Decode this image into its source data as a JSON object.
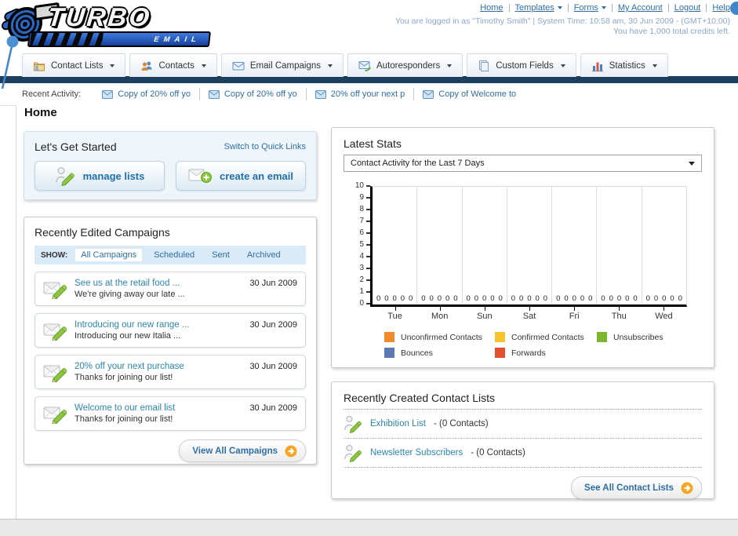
{
  "colors": {
    "navy_bar": "#1c3f60",
    "link_blue": "#2f6fa7",
    "accent_orange": "#f5a623",
    "pencil_green": "#8cc63e"
  },
  "header": {
    "logo_line1": "TURBO",
    "logo_line2": "EMAIL",
    "links": [
      {
        "label": "Home",
        "dropdown": false
      },
      {
        "label": "Templates",
        "dropdown": true
      },
      {
        "label": "Forms",
        "dropdown": true
      },
      {
        "label": "My Account",
        "dropdown": false
      },
      {
        "label": "Logout",
        "dropdown": false
      },
      {
        "label": "Help",
        "dropdown": false
      }
    ],
    "login_line": "You are logged in as \"Timothy Smith\" | System Time: 10:58 am, 30 Jun 2009 - (GMT+10:00)",
    "credits_line": "You have 1,000 total credits left."
  },
  "nav": {
    "tabs": [
      {
        "label": "Contact Lists",
        "icon": "folder"
      },
      {
        "label": "Contacts",
        "icon": "people"
      },
      {
        "label": "Email Campaigns",
        "icon": "envelope"
      },
      {
        "label": "Autoresponders",
        "icon": "envelope-arrow"
      },
      {
        "label": "Custom Fields",
        "icon": "pages"
      },
      {
        "label": "Statistics",
        "icon": "barchart"
      }
    ]
  },
  "recent_activity": {
    "label": "Recent Activity:",
    "items": [
      "Copy of 20% off yo",
      "Copy of 20% off yo",
      "20% off your next p",
      "Copy of Welcome to"
    ]
  },
  "page": {
    "title": "Home"
  },
  "get_started": {
    "title": "Let's Get Started",
    "switch_link": "Switch to Quick Links",
    "buttons": [
      {
        "label": "manage lists",
        "icon": "person-pencil"
      },
      {
        "label": "create an email",
        "icon": "envelope-plus"
      }
    ]
  },
  "campaigns": {
    "title": "Recently Edited Campaigns",
    "show_label": "SHOW:",
    "filters": [
      {
        "label": "All Campaigns",
        "active": true
      },
      {
        "label": "Scheduled",
        "active": false
      },
      {
        "label": "Sent",
        "active": false
      },
      {
        "label": "Archived",
        "active": false
      }
    ],
    "items": [
      {
        "title": "See us at the retail food ...",
        "subtitle": "We're giving away our late ...",
        "date": "30 Jun 2009"
      },
      {
        "title": "Introducing our new range ...",
        "subtitle": "Introducing our new Italia ...",
        "date": "30 Jun 2009"
      },
      {
        "title": "20% off your next purchase",
        "subtitle": "Thanks for joining our list!",
        "date": "30 Jun 2009"
      },
      {
        "title": "Welcome to our email list",
        "subtitle": "Thanks for joining our list!",
        "date": "30 Jun 2009"
      }
    ],
    "view_all_label": "View All Campaigns"
  },
  "stats": {
    "title": "Latest Stats",
    "dropdown_value": "Contact Activity for the Last 7 Days"
  },
  "chart_data": {
    "type": "bar",
    "title": "Contact Activity for the Last 7 Days",
    "categories": [
      "Tue",
      "Mon",
      "Sun",
      "Sat",
      "Fri",
      "Thu",
      "Wed"
    ],
    "series": [
      {
        "name": "Unconfirmed Contacts",
        "color": "#f28a2a",
        "values": [
          0,
          0,
          0,
          0,
          0,
          0,
          0
        ]
      },
      {
        "name": "Confirmed Contacts",
        "color": "#f7c32e",
        "values": [
          0,
          0,
          0,
          0,
          0,
          0,
          0
        ]
      },
      {
        "name": "Unsubscribes",
        "color": "#7cb52e",
        "values": [
          0,
          0,
          0,
          0,
          0,
          0,
          0
        ]
      },
      {
        "name": "Bounces",
        "color": "#5b79b2",
        "values": [
          0,
          0,
          0,
          0,
          0,
          0,
          0
        ]
      },
      {
        "name": "Forwards",
        "color": "#e2502f",
        "values": [
          0,
          0,
          0,
          0,
          0,
          0,
          0
        ]
      }
    ],
    "ylim": [
      0,
      10
    ],
    "yticks": [
      0,
      1,
      2,
      3,
      4,
      5,
      6,
      7,
      8,
      9,
      10
    ],
    "show_value_labels": true,
    "legend_position": "bottom",
    "grid": "vertical-group-separators"
  },
  "contact_lists": {
    "title": "Recently Created Contact Lists",
    "items": [
      {
        "name": "Exhibition List",
        "suffix": "- (0 Contacts)"
      },
      {
        "name": "Newsletter Subscribers",
        "suffix": "- (0 Contacts)"
      }
    ],
    "see_all_label": "See All Contact Lists"
  }
}
